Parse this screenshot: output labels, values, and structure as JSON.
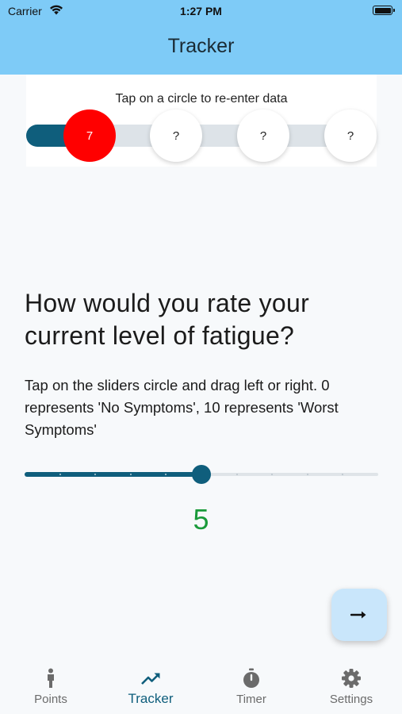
{
  "status_bar": {
    "carrier": "Carrier",
    "time": "1:27 PM"
  },
  "app_bar": {
    "title": "Tracker"
  },
  "progress": {
    "hint": "Tap on a circle to re-enter data",
    "steps": [
      {
        "label": "7",
        "state": "done"
      },
      {
        "label": "?",
        "state": "pending"
      },
      {
        "label": "?",
        "state": "pending"
      },
      {
        "label": "?",
        "state": "pending"
      }
    ],
    "colors": {
      "done": "#ff0000",
      "track_fill": "#0f5e7c",
      "track": "#dde3e8"
    }
  },
  "question": {
    "title": "How would you rate your current level of fatigue?",
    "instructions": "Tap on the sliders circle and drag left or right. 0 represents 'No Symptoms', 10 represents 'Worst Symptoms'"
  },
  "slider": {
    "min": 0,
    "max": 10,
    "value": 5,
    "value_label": "5",
    "color": "#0f5e7c",
    "value_color": "#1a9a3a"
  },
  "fab": {
    "icon": "arrow-right-icon"
  },
  "bottom_nav": {
    "items": [
      {
        "label": "Points",
        "icon": "person-icon",
        "active": false
      },
      {
        "label": "Tracker",
        "icon": "trending-up-icon",
        "active": true
      },
      {
        "label": "Timer",
        "icon": "timer-icon",
        "active": false
      },
      {
        "label": "Settings",
        "icon": "gear-icon",
        "active": false
      }
    ]
  }
}
